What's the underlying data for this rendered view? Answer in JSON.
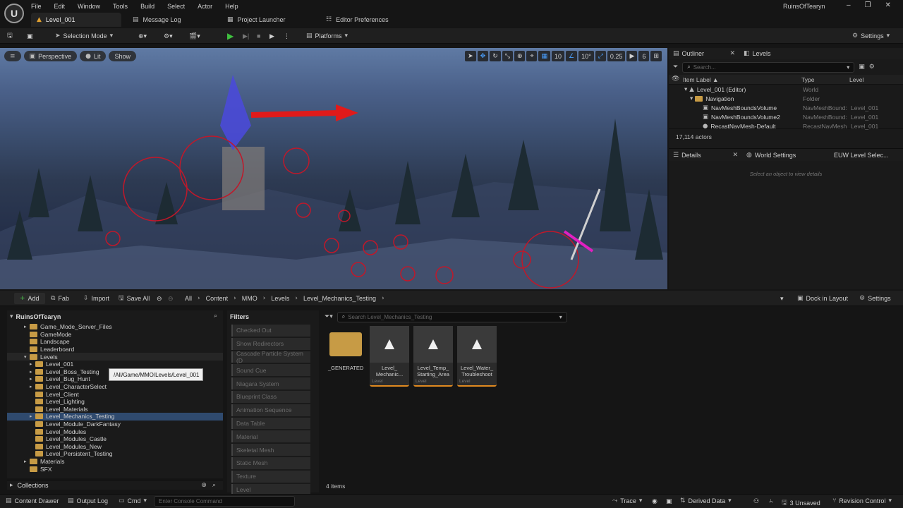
{
  "menu": [
    "File",
    "Edit",
    "Window",
    "Tools",
    "Build",
    "Select",
    "Actor",
    "Help"
  ],
  "project_name": "RuinsOfTearyn",
  "tabs": [
    {
      "label": "Level_001"
    },
    {
      "label": "Message Log"
    },
    {
      "label": "Project Launcher"
    },
    {
      "label": "Editor Preferences"
    }
  ],
  "toolbar": {
    "selection_mode": "Selection Mode",
    "platforms": "Platforms",
    "settings": "Settings"
  },
  "viewport": {
    "perspective": "Perspective",
    "lit": "Lit",
    "show": "Show",
    "grid_snap": "10",
    "rotation_snap": "10°",
    "scale_snap": "0.25",
    "camera_speed": "6"
  },
  "outliner": {
    "tab_outliner": "Outliner",
    "tab_levels": "Levels",
    "search_placeholder": "Search...",
    "col_label": "Item Label ▲",
    "col_type": "Type",
    "col_level": "Level",
    "rows": [
      {
        "label": "Level_001 (Editor)",
        "type": "World",
        "level": ""
      },
      {
        "label": "Navigation",
        "type": "Folder",
        "level": ""
      },
      {
        "label": "NavMeshBoundsVolume",
        "type": "NavMeshBound:",
        "level": "Level_001"
      },
      {
        "label": "NavMeshBoundsVolume2",
        "type": "NavMeshBound:",
        "level": "Level_001"
      },
      {
        "label": "RecastNavMesh-Default",
        "type": "RecastNavMesh",
        "level": "Level_001"
      }
    ],
    "actor_count": "17,114 actors"
  },
  "details": {
    "tab_details": "Details",
    "tab_world_settings": "World Settings",
    "tab_euw": "EUW Level Selec...",
    "empty_text": "Select an object to view details"
  },
  "content_browser": {
    "add": "Add",
    "fab": "Fab",
    "import": "Import",
    "save_all": "Save All",
    "breadcrumb": [
      "All",
      "Content",
      "MMO",
      "Levels",
      "Level_Mechanics_Testing"
    ],
    "dock_in_layout": "Dock in Layout",
    "settings": "Settings",
    "root": "RuinsOfTearyn",
    "tree": [
      {
        "label": "Game_Mode_Server_Files",
        "depth": 1,
        "arrow": true
      },
      {
        "label": "GameMode",
        "depth": 1,
        "arrow": false
      },
      {
        "label": "Landscape",
        "depth": 1,
        "arrow": false
      },
      {
        "label": "Leaderboard",
        "depth": 1,
        "arrow": false
      },
      {
        "label": "Levels",
        "depth": 1,
        "arrow": true,
        "open": true
      },
      {
        "label": "Level_001",
        "depth": 2,
        "arrow": true
      },
      {
        "label": "Level_Boss_Testing",
        "depth": 2,
        "arrow": true
      },
      {
        "label": "Level_Bug_Hunt",
        "depth": 2,
        "arrow": true
      },
      {
        "label": "Level_CharacterSelect",
        "depth": 2,
        "arrow": true
      },
      {
        "label": "Level_Client",
        "depth": 2,
        "arrow": false
      },
      {
        "label": "Level_Lighting",
        "depth": 2,
        "arrow": false
      },
      {
        "label": "Level_Materials",
        "depth": 2,
        "arrow": false
      },
      {
        "label": "Level_Mechanics_Testing",
        "depth": 2,
        "arrow": true,
        "selected": true
      },
      {
        "label": "Level_Module_DarkFantasy",
        "depth": 2,
        "arrow": false
      },
      {
        "label": "Level_Modules",
        "depth": 2,
        "arrow": false
      },
      {
        "label": "Level_Modules_Castle",
        "depth": 2,
        "arrow": false
      },
      {
        "label": "Level_Modules_New",
        "depth": 2,
        "arrow": false
      },
      {
        "label": "Level_Persistent_Testing",
        "depth": 2,
        "arrow": false
      },
      {
        "label": "Materials",
        "depth": 1,
        "arrow": true
      },
      {
        "label": "SFX",
        "depth": 1,
        "arrow": false
      }
    ],
    "tooltip": "/All/Game/MMO/Levels/Level_001",
    "collections": "Collections",
    "filters_title": "Filters",
    "filters": [
      "Checked Out",
      "Show Redirectors",
      "Cascade Particle System (D",
      "Sound Cue",
      "Niagara System",
      "Blueprint Class",
      "Animation Sequence",
      "Data Table",
      "Material",
      "Skeletal Mesh",
      "Static Mesh",
      "Texture",
      "Level"
    ],
    "search_placeholder": "Search Level_Mechanics_Testing",
    "assets": [
      {
        "name": "_GENERATED",
        "kind": "",
        "folder": true
      },
      {
        "name": "Level_ Mechanic...",
        "kind": "Level",
        "folder": false
      },
      {
        "name": "Level_Temp_ Starting_Area",
        "kind": "Level",
        "folder": false
      },
      {
        "name": "Level_Water_ Troubleshoot",
        "kind": "Level",
        "folder": false
      }
    ],
    "item_count": "4 items"
  },
  "statusbar": {
    "content_drawer": "Content Drawer",
    "output_log": "Output Log",
    "cmd": "Cmd",
    "console_placeholder": "Enter Console Command",
    "trace": "Trace",
    "derived_data": "Derived Data",
    "unsaved": "3 Unsaved",
    "revision_control": "Revision Control"
  }
}
